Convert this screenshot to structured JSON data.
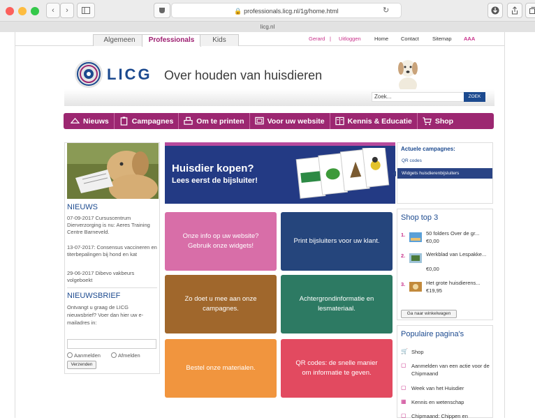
{
  "browser": {
    "url": "professionals.licg.nl/1g/home.html",
    "tab_title": "licg.nl"
  },
  "top_tabs": [
    "Algemeen",
    "Professionals",
    "Kids"
  ],
  "top_links": {
    "user": "Gerard",
    "separator": "|",
    "logout": "Uitloggen",
    "home": "Home",
    "contact": "Contact",
    "sitemap": "Sitemap",
    "font_size": "AAA"
  },
  "header": {
    "logo_text": "LICG",
    "tagline": "Over houden van huisdieren"
  },
  "search": {
    "placeholder": "Zoek...",
    "button": "ZOEK"
  },
  "nav": [
    {
      "label": "Nieuws",
      "icon": "megaphone-icon"
    },
    {
      "label": "Campagnes",
      "icon": "clipboard-icon"
    },
    {
      "label": "Om te printen",
      "icon": "printer-icon"
    },
    {
      "label": "Voor uw website",
      "icon": "monitor-icon"
    },
    {
      "label": "Kennis & Educatie",
      "icon": "book-icon"
    },
    {
      "label": "Shop",
      "icon": "cart-icon"
    }
  ],
  "nieuws": {
    "title": "NIEUWS",
    "items": [
      "07-09-2017 Cursuscentrum Dierverzorging is nu: Aeres Training Centre Barneveld.",
      "13-07-2017: Consensus vaccineren en titerbepalingen bij hond en kat",
      "29-06-2017 Dibevo vakbeurs volgeboekt"
    ]
  },
  "nieuwsbrief": {
    "title": "NIEUWSBRIEF",
    "text": "Ontvangt u graag de LICG nieuwsbrief? Voer dan hier uw e-mailadres in:",
    "aanmelden": "Aanmelden",
    "afmelden": "Afmelden",
    "button": "Verzenden"
  },
  "banner": {
    "title": "Huisdier kopen?",
    "subtitle": "Lees eerst de bijsluiter!"
  },
  "campaigns": {
    "title": "Actuele campagnes:",
    "items": [
      "QR codes",
      "Widgets huisdierenbijsluiters"
    ]
  },
  "tiles": [
    {
      "label": "Onze info op uw website? Gebruik onze widgets!",
      "color": "#d86ea8"
    },
    {
      "label": "Print bijsluiters voor uw klant.",
      "color": "#25457c"
    },
    {
      "label": "Zo doet u mee aan onze campagnes.",
      "color": "#a0672c"
    },
    {
      "label": "Achtergrondinformatie en lesmateriaal.",
      "color": "#2d7a63"
    },
    {
      "label": "Bestel onze materialen.",
      "color": "#f1953e"
    },
    {
      "label": "QR codes: de snelle manier om informatie te geven.",
      "color": "#e24a60"
    }
  ],
  "shop_top": {
    "title": "Shop top 3",
    "items": [
      {
        "num": "1.",
        "name": "50 folders Over de gr...",
        "price": "€0,00"
      },
      {
        "num": "2.",
        "name": "Werkblad van Lespakke...",
        "price": "€0,00"
      },
      {
        "num": "3.",
        "name": "Het grote huisdierens...",
        "price": "€19,95"
      }
    ],
    "button": "Ga naar winkelwagen"
  },
  "popular": {
    "title": "Populaire pagina's",
    "items": [
      "Shop",
      "Aanmelden van een actie voor de Chipmaand",
      "Week van het Huisdier",
      "Kennis en wetenschap",
      "Chipmaand: Chippen en"
    ]
  },
  "colors": {
    "brand_purple": "#9c2771",
    "brand_blue": "#1c4a8f"
  }
}
